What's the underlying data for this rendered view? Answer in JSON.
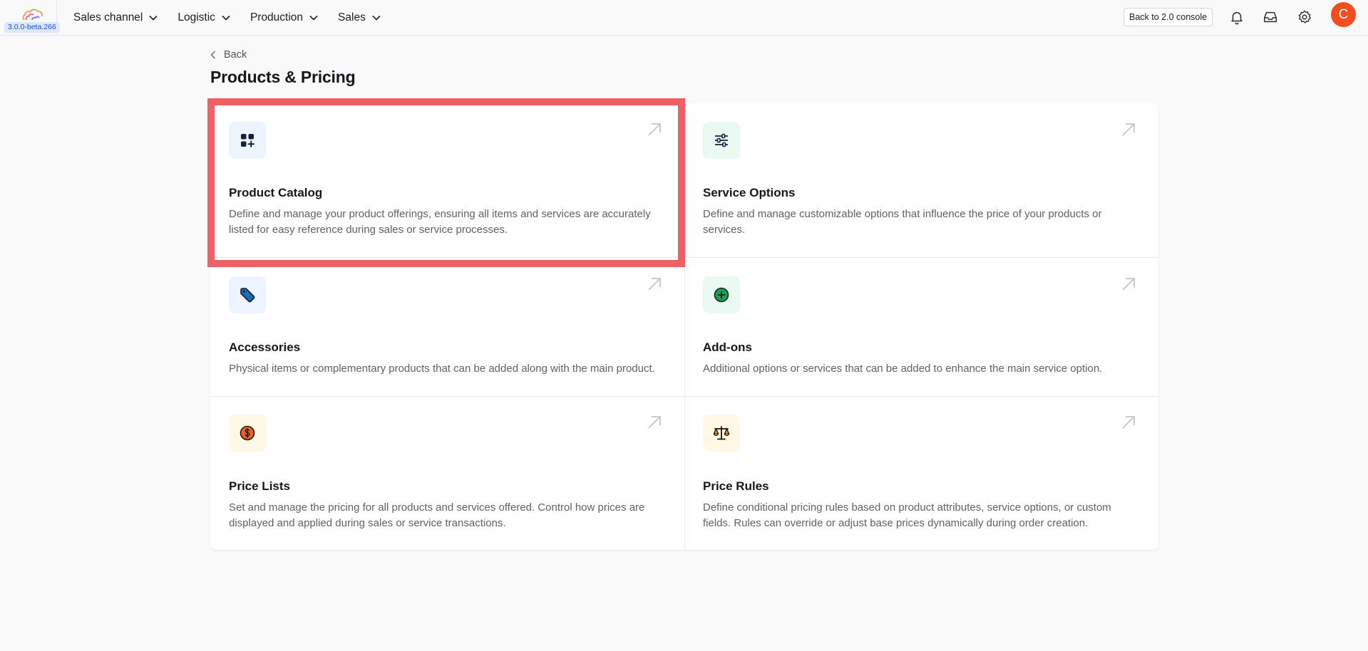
{
  "app": {
    "version": "3.0.0-beta.266"
  },
  "nav": {
    "items": [
      {
        "label": "Sales channel"
      },
      {
        "label": "Logistic"
      },
      {
        "label": "Production"
      },
      {
        "label": "Sales"
      }
    ]
  },
  "header": {
    "console_button": "Back to 2.0 console",
    "icons": [
      "bell-icon",
      "inbox-icon",
      "gear-icon"
    ],
    "avatar_initial": "C"
  },
  "page": {
    "back_label": "Back",
    "title": "Products & Pricing"
  },
  "cards": [
    {
      "title": "Product Catalog",
      "description": "Define and manage your product offerings, ensuring all items and services are accurately listed for easy reference during sales or service processes.",
      "icon": "grid-plus-icon",
      "icon_bg": "#eef4fe",
      "highlighted": true
    },
    {
      "title": "Service Options",
      "description": "Define and manage customizable options that influence the price of your products or services.",
      "icon": "sliders-icon",
      "icon_bg": "#eafaf2"
    },
    {
      "title": "Accessories",
      "description": "Physical items or complementary products that can be added along with the main product.",
      "icon": "tag-icon",
      "icon_bg": "#eef4fe"
    },
    {
      "title": "Add-ons",
      "description": "Additional options or services that can be added to enhance the main service option.",
      "icon": "plus-circle-icon",
      "icon_bg": "#eafaf2"
    },
    {
      "title": "Price Lists",
      "description": "Set and manage the pricing for all products and services offered. Control how prices are displayed and applied during sales or service transactions.",
      "icon": "dollar-coin-icon",
      "icon_bg": "#fff8e6"
    },
    {
      "title": "Price Rules",
      "description": "Define conditional pricing rules based on product attributes, service options, or custom fields. Rules can override or adjust base prices dynamically during order creation.",
      "icon": "scale-icon",
      "icon_bg": "#fff8e6"
    }
  ],
  "colors": {
    "highlight_border": "#ef5f66",
    "avatar_bg": "#f24e1e",
    "version_badge_bg": "#dbe8fb"
  }
}
